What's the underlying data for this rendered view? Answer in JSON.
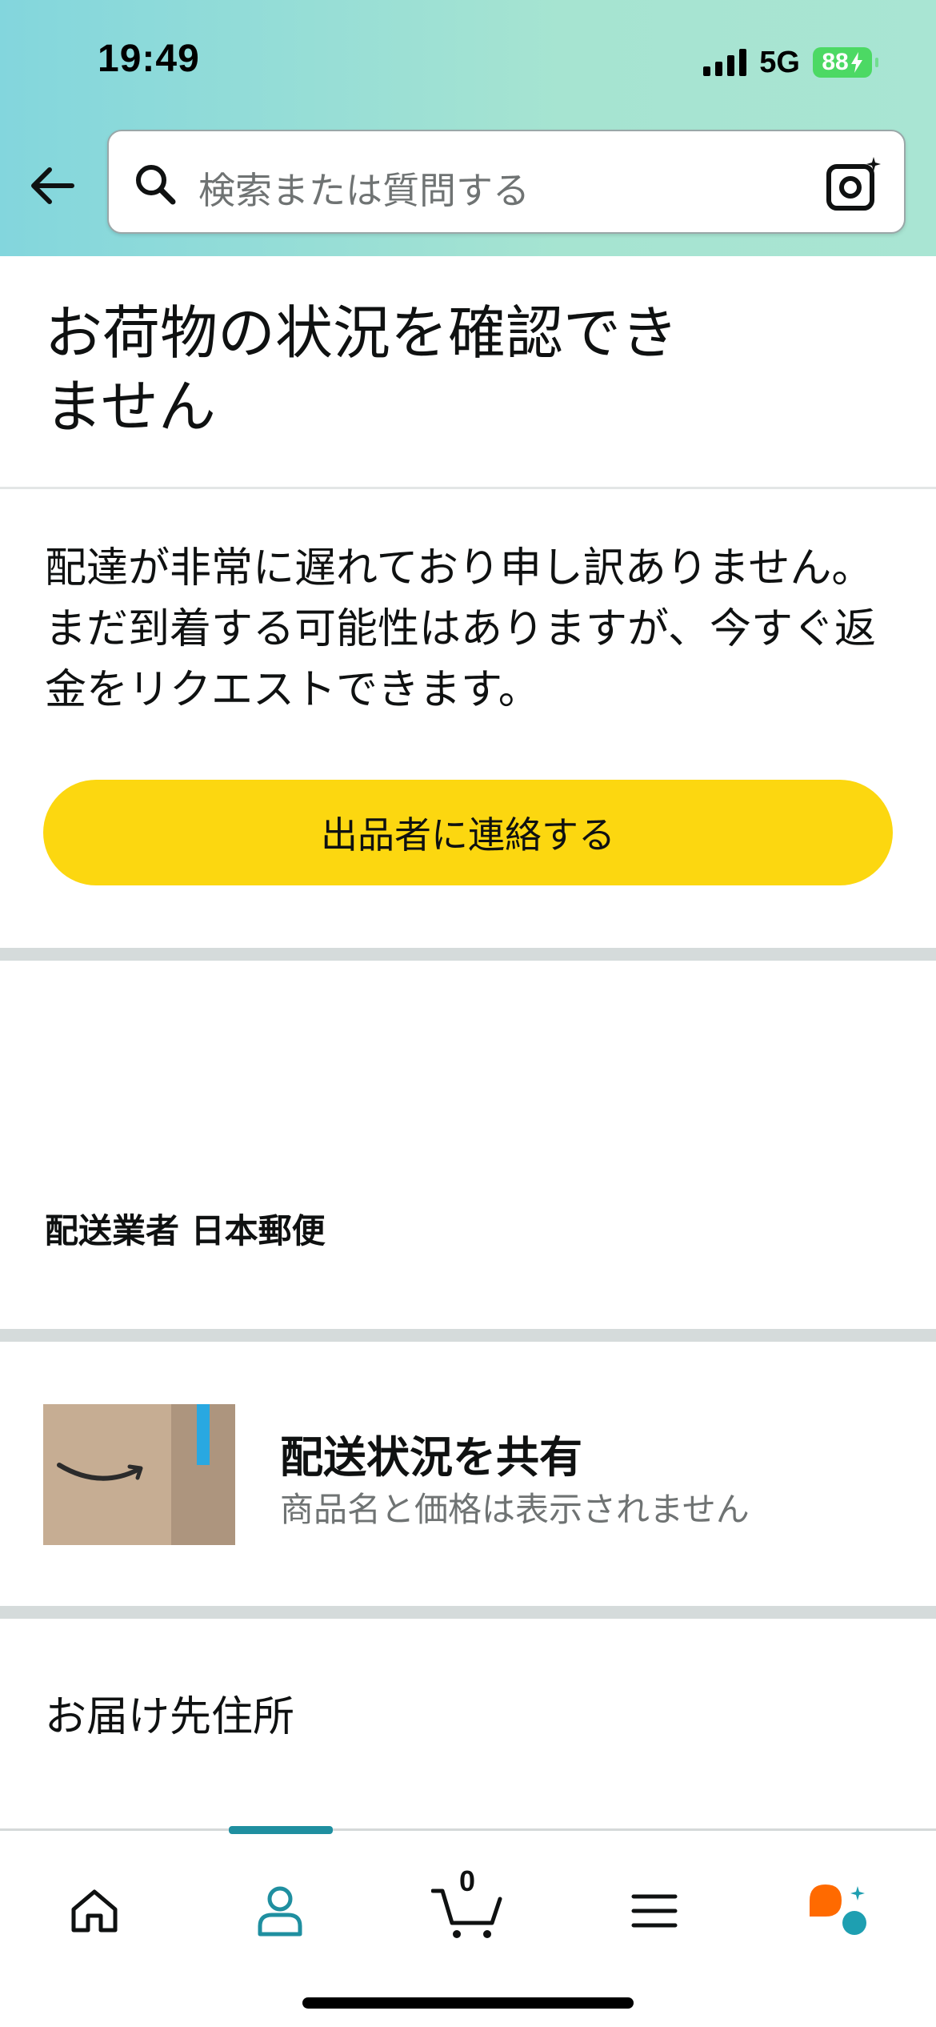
{
  "status_bar": {
    "time": "19:49",
    "network": "5G",
    "battery": "88"
  },
  "search": {
    "placeholder": "検索または質問する"
  },
  "page": {
    "title": "お荷物の状況を確認できません",
    "message": "配達が非常に遅れており申し訳ありません。まだ到着する可能性はありますが、今すぐ返金をリクエストできます。",
    "contact_button": "出品者に連絡する",
    "carrier": "配送業者 日本郵便",
    "share_title": "配送状況を共有",
    "share_subtitle": "商品名と価格は表示されません",
    "address_heading": "お届け先住所"
  },
  "nav": {
    "cart_count": "0",
    "items": [
      "home-icon",
      "account-icon",
      "cart-icon",
      "menu-icon",
      "assistant-icon"
    ],
    "active": "account-icon"
  },
  "colors": {
    "header_gradient": [
      "#83d6dd",
      "#a9e5d3"
    ],
    "button": "#fcd710",
    "accent": "#1f8fa0",
    "battery": "#4cd964"
  }
}
